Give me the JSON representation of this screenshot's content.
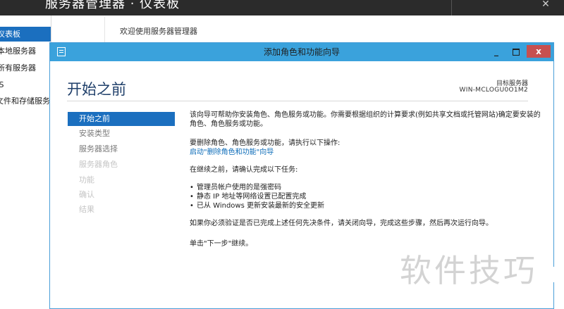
{
  "server_manager": {
    "title": "服务器管理器 · 仪表板",
    "welcome": "欢迎使用服务器管理器",
    "close_glyph": "✕",
    "nav_items": [
      {
        "label": "仪表板",
        "active": true
      },
      {
        "label": "本地服务器",
        "active": false
      },
      {
        "label": "所有服务器",
        "active": false
      },
      {
        "label": "IIS",
        "active": false
      },
      {
        "label": "文件和存储服务",
        "active": false
      }
    ]
  },
  "wizard": {
    "title": "添加角色和功能向导",
    "controls": {
      "minimize": "_",
      "close": "x"
    },
    "heading": "开始之前",
    "target_server_label": "目标服务器",
    "target_server_value": "WIN-MCLOGU0O1M2",
    "steps": [
      {
        "label": "开始之前",
        "state": "current"
      },
      {
        "label": "安装类型",
        "state": "enabled"
      },
      {
        "label": "服务器选择",
        "state": "enabled"
      },
      {
        "label": "服务器角色",
        "state": "disabled"
      },
      {
        "label": "功能",
        "state": "disabled"
      },
      {
        "label": "确认",
        "state": "disabled"
      },
      {
        "label": "结果",
        "state": "disabled"
      }
    ],
    "content": {
      "intro": "该向导可帮助你安装角色、角色服务或功能。你需要根据组织的计算要求(例如共享文档或托管网站)确定要安装的角色、角色服务或功能。",
      "remove_text": "要删除角色、角色服务或功能，请执行以下操作:",
      "remove_link": "启动\"删除角色和功能\"向导",
      "before_text": "在继续之前，请确认完成以下任务:",
      "tasks": [
        "管理员帐户使用的是强密码",
        "静态 IP 地址等网络设置已配置完成",
        "已从 Windows 更新安装最新的安全更新"
      ],
      "verify_text": "如果你必须验证是否已完成上述任何先决条件，请关闭向导，完成这些步骤，然后再次运行向导。",
      "next_text": "单击\"下一步\"继续。"
    }
  },
  "watermark": "软件技巧"
}
